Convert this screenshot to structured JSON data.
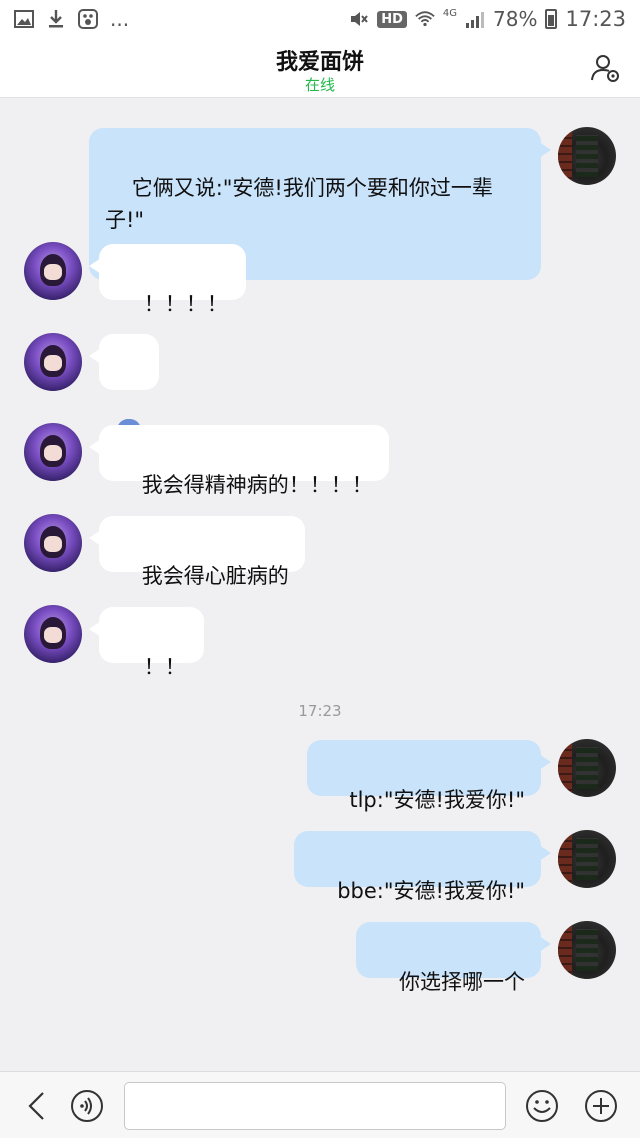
{
  "status_bar": {
    "signal_label": "4G",
    "hd_label": "HD",
    "battery": "78%",
    "time": "17:23",
    "more_dots": "...",
    "icons": [
      "image-icon",
      "download-icon",
      "paw-icon",
      "mute-icon",
      "wifi-icon",
      "signal-icon",
      "battery-icon"
    ]
  },
  "header": {
    "title": "我爱面饼",
    "status": "在线",
    "status_color": "#23b94d"
  },
  "messages": [
    {
      "side": "out",
      "text": "它俩又说:\"安德!我们两个要和你过一辈\n子!\""
    },
    {
      "side": "in",
      "text": "！！！！"
    },
    {
      "side": "in",
      "emoji": "fearful-face"
    },
    {
      "side": "in",
      "text": "我会得精神病的！！！！"
    },
    {
      "side": "in",
      "text": "我会得心脏病的"
    },
    {
      "side": "in",
      "text": "！！"
    },
    {
      "side": "out",
      "text": "tlp:\"安德!我爱你!\""
    },
    {
      "side": "out",
      "text": "bbe:\"安德!我爱你!\""
    },
    {
      "side": "out",
      "text": "你选择哪一个"
    }
  ],
  "timestamp": "17:23",
  "bottom_bar": {
    "input_placeholder": "",
    "icons": [
      "back-icon",
      "voice-icon",
      "emoji-icon",
      "plus-icon"
    ]
  },
  "colors": {
    "outgoing_bubble": "#c9e3fb",
    "incoming_bubble": "#ffffff",
    "background": "#f0f0f2"
  }
}
